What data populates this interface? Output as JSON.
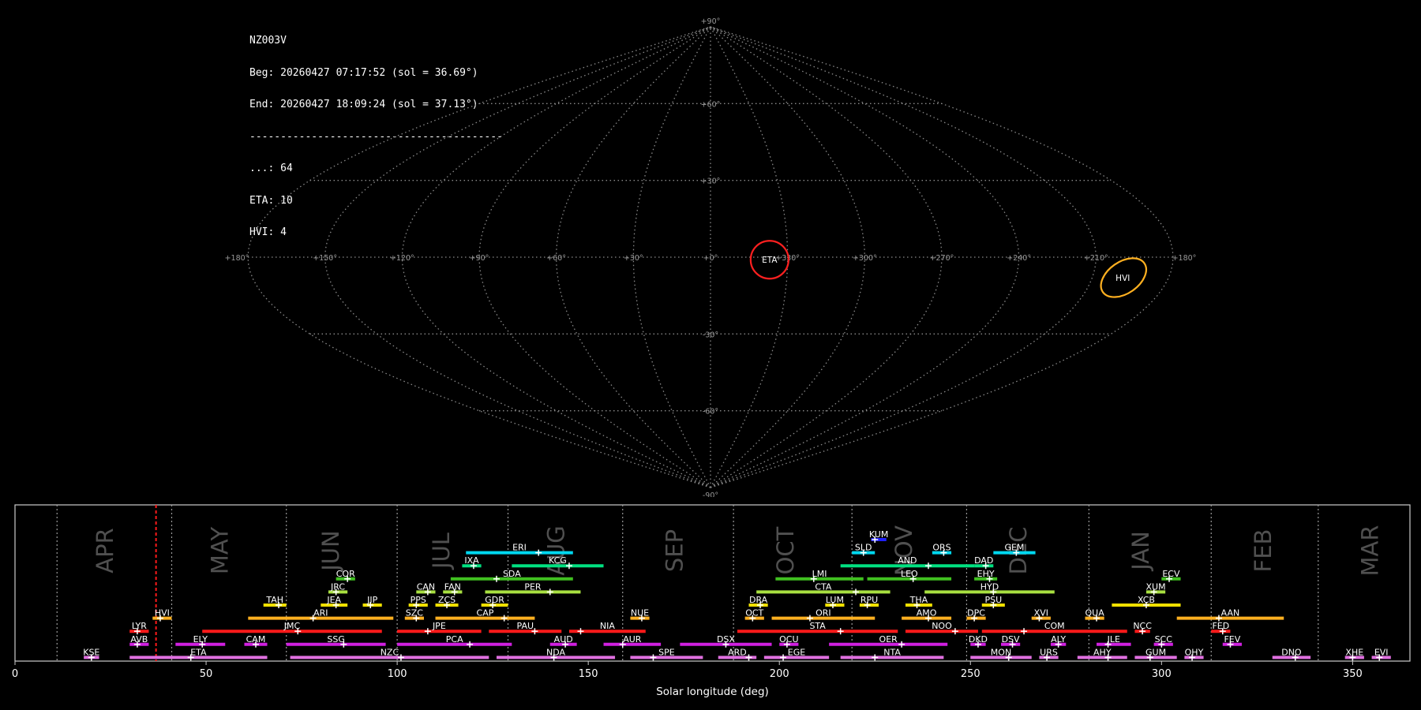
{
  "info": {
    "station": "NZ003V",
    "beg": "Beg: 20260427 07:17:52 (sol = 36.69°)",
    "end": "End: 20260427 18:09:24 (sol = 37.13°)",
    "separator": "-----------------------------------------",
    "counts": [
      "...: 64",
      "ETA: 10",
      "HVI: 4"
    ]
  },
  "sky_map": {
    "projection": "sinusoidal",
    "lon_labels": [
      "+180°",
      "+150°",
      "+120°",
      "+90°",
      "+60°",
      "+30°",
      "+0°",
      "+330°",
      "+300°",
      "+270°",
      "+240°",
      "+210°",
      "+180°"
    ],
    "lat_labels": [
      "+90°",
      "+60°",
      "+30°",
      "+0°",
      "-30°",
      "-60°",
      "-90°"
    ],
    "radiant_circles": [
      {
        "name": "ETA",
        "lon": 337,
        "lat": -1,
        "color": "#ff2020"
      },
      {
        "name": "HVI",
        "lon": 198,
        "lat": -8,
        "color": "#ffb020"
      }
    ]
  },
  "chart_data": {
    "type": "timeline",
    "xlabel": "Solar longitude (deg)",
    "xlim": [
      0,
      365
    ],
    "xticks": [
      0,
      50,
      100,
      150,
      200,
      250,
      300,
      350
    ],
    "grid": "vertical dotted month boundaries",
    "current_sol": 36.9,
    "months": [
      {
        "label": "APR",
        "center": 24
      },
      {
        "label": "MAY",
        "center": 54
      },
      {
        "label": "JUN",
        "center": 83
      },
      {
        "label": "JUL",
        "center": 112
      },
      {
        "label": "AUG",
        "center": 142
      },
      {
        "label": "SEP",
        "center": 173
      },
      {
        "label": "OCT",
        "center": 202
      },
      {
        "label": "NOV",
        "center": 233
      },
      {
        "label": "DEC",
        "center": 263
      },
      {
        "label": "JAN",
        "center": 295
      },
      {
        "label": "FEB",
        "center": 327
      },
      {
        "label": "MAR",
        "center": 355
      }
    ],
    "month_boundaries": [
      11,
      41,
      71,
      100,
      129,
      159,
      188,
      219,
      249,
      281,
      313,
      341
    ],
    "showers": [
      {
        "name": "KUM",
        "start": 224,
        "end": 228,
        "peak": 225,
        "row": 0,
        "color": "#2020ff"
      },
      {
        "name": "ERI",
        "start": 118,
        "end": 146,
        "peak": 137,
        "row": 1,
        "color": "#00d8f0"
      },
      {
        "name": "SLD",
        "start": 219,
        "end": 225,
        "peak": 222,
        "row": 1,
        "color": "#00d8f0"
      },
      {
        "name": "ORS",
        "start": 240,
        "end": 245,
        "peak": 243,
        "row": 1,
        "color": "#00d8f0"
      },
      {
        "name": "GEM",
        "start": 256,
        "end": 267,
        "peak": 262,
        "row": 1,
        "color": "#00d8f0"
      },
      {
        "name": "IXA",
        "start": 117,
        "end": 122,
        "peak": 120,
        "row": 2,
        "color": "#00e080"
      },
      {
        "name": "KCG",
        "start": 130,
        "end": 154,
        "peak": 145,
        "row": 2,
        "color": "#00e080"
      },
      {
        "name": "AND",
        "start": 216,
        "end": 251,
        "peak": 239,
        "row": 2,
        "color": "#00e080"
      },
      {
        "name": "DAD",
        "start": 251,
        "end": 256,
        "peak": 254,
        "row": 2,
        "color": "#00e080"
      },
      {
        "name": "COR",
        "start": 84,
        "end": 89,
        "peak": 87,
        "row": 3,
        "color": "#40c020"
      },
      {
        "name": "SDA",
        "start": 114,
        "end": 146,
        "peak": 126,
        "row": 3,
        "color": "#40c020"
      },
      {
        "name": "LMI",
        "start": 199,
        "end": 222,
        "peak": 209,
        "row": 3,
        "color": "#40c020"
      },
      {
        "name": "LEO",
        "start": 223,
        "end": 245,
        "peak": 235,
        "row": 3,
        "color": "#40c020"
      },
      {
        "name": "EHY",
        "start": 251,
        "end": 257,
        "peak": 255,
        "row": 3,
        "color": "#40c020"
      },
      {
        "name": "ECV",
        "start": 300,
        "end": 305,
        "peak": 302,
        "row": 3,
        "color": "#40c020"
      },
      {
        "name": "JRC",
        "start": 82,
        "end": 87,
        "peak": 84,
        "row": 4,
        "color": "#a8e040"
      },
      {
        "name": "CAN",
        "start": 105,
        "end": 110,
        "peak": 108,
        "row": 4,
        "color": "#a8e040"
      },
      {
        "name": "FAN",
        "start": 112,
        "end": 117,
        "peak": 115,
        "row": 4,
        "color": "#a8e040"
      },
      {
        "name": "PER",
        "start": 123,
        "end": 148,
        "peak": 140,
        "row": 4,
        "color": "#a8e040"
      },
      {
        "name": "CTA",
        "start": 194,
        "end": 229,
        "peak": 220,
        "row": 4,
        "color": "#a8e040"
      },
      {
        "name": "HYD",
        "start": 238,
        "end": 272,
        "peak": 256,
        "row": 4,
        "color": "#a8e040"
      },
      {
        "name": "XUM",
        "start": 296,
        "end": 301,
        "peak": 298,
        "row": 4,
        "color": "#a8e040"
      },
      {
        "name": "TAH",
        "start": 65,
        "end": 71,
        "peak": 69,
        "row": 5,
        "color": "#f0e000"
      },
      {
        "name": "JEA",
        "start": 80,
        "end": 87,
        "peak": 84,
        "row": 5,
        "color": "#f0e000"
      },
      {
        "name": "JIP",
        "start": 91,
        "end": 96,
        "peak": 93,
        "row": 5,
        "color": "#f0e000"
      },
      {
        "name": "PPS",
        "start": 103,
        "end": 108,
        "peak": 105,
        "row": 5,
        "color": "#f0e000"
      },
      {
        "name": "ZCS",
        "start": 110,
        "end": 116,
        "peak": 113,
        "row": 5,
        "color": "#f0e000"
      },
      {
        "name": "GDR",
        "start": 122,
        "end": 129,
        "peak": 125,
        "row": 5,
        "color": "#f0e000"
      },
      {
        "name": "DRA",
        "start": 192,
        "end": 197,
        "peak": 195,
        "row": 5,
        "color": "#f0e000"
      },
      {
        "name": "LUM",
        "start": 212,
        "end": 217,
        "peak": 214,
        "row": 5,
        "color": "#f0e000"
      },
      {
        "name": "RPU",
        "start": 221,
        "end": 226,
        "peak": 223,
        "row": 5,
        "color": "#f0e000"
      },
      {
        "name": "THA",
        "start": 233,
        "end": 240,
        "peak": 236,
        "row": 5,
        "color": "#f0e000"
      },
      {
        "name": "PSU",
        "start": 253,
        "end": 259,
        "peak": 256,
        "row": 5,
        "color": "#f0e000"
      },
      {
        "name": "XCB",
        "start": 287,
        "end": 305,
        "peak": 296,
        "row": 5,
        "color": "#f0e000"
      },
      {
        "name": "HVI",
        "start": 36,
        "end": 41,
        "peak": 38,
        "row": 6,
        "color": "#ffb020"
      },
      {
        "name": "ARI",
        "start": 61,
        "end": 99,
        "peak": 78,
        "row": 6,
        "color": "#ffb020"
      },
      {
        "name": "SZC",
        "start": 102,
        "end": 107,
        "peak": 105,
        "row": 6,
        "color": "#ffb020"
      },
      {
        "name": "CAP",
        "start": 110,
        "end": 136,
        "peak": 128,
        "row": 6,
        "color": "#ffb020"
      },
      {
        "name": "NUE",
        "start": 161,
        "end": 166,
        "peak": 164,
        "row": 6,
        "color": "#ffb020"
      },
      {
        "name": "OCT",
        "start": 191,
        "end": 196,
        "peak": 193,
        "row": 6,
        "color": "#ffb020"
      },
      {
        "name": "ORI",
        "start": 198,
        "end": 225,
        "peak": 208,
        "row": 6,
        "color": "#ffb020"
      },
      {
        "name": "AMO",
        "start": 232,
        "end": 245,
        "peak": 239,
        "row": 6,
        "color": "#ffb020"
      },
      {
        "name": "DPC",
        "start": 249,
        "end": 254,
        "peak": 251,
        "row": 6,
        "color": "#ffb020"
      },
      {
        "name": "XVI",
        "start": 266,
        "end": 271,
        "peak": 268,
        "row": 6,
        "color": "#ffb020"
      },
      {
        "name": "QUA",
        "start": 280,
        "end": 285,
        "peak": 283,
        "row": 6,
        "color": "#ffb020"
      },
      {
        "name": "AAN",
        "start": 304,
        "end": 332,
        "peak": 315,
        "row": 6,
        "color": "#ffb020"
      },
      {
        "name": "LYR",
        "start": 30,
        "end": 35,
        "peak": 32,
        "row": 7,
        "color": "#ff1a1a"
      },
      {
        "name": "JMC",
        "start": 49,
        "end": 96,
        "peak": 74,
        "row": 7,
        "color": "#ff1a1a"
      },
      {
        "name": "JPE",
        "start": 100,
        "end": 122,
        "peak": 108,
        "row": 7,
        "color": "#ff1a1a"
      },
      {
        "name": "PAU",
        "start": 124,
        "end": 143,
        "peak": 136,
        "row": 7,
        "color": "#ff1a1a"
      },
      {
        "name": "NIA",
        "start": 145,
        "end": 165,
        "peak": 148,
        "row": 7,
        "color": "#ff1a1a"
      },
      {
        "name": "STA",
        "start": 189,
        "end": 231,
        "peak": 216,
        "row": 7,
        "color": "#ff1a1a"
      },
      {
        "name": "NOO",
        "start": 233,
        "end": 252,
        "peak": 246,
        "row": 7,
        "color": "#ff1a1a"
      },
      {
        "name": "COM",
        "start": 253,
        "end": 291,
        "peak": 264,
        "row": 7,
        "color": "#ff1a1a"
      },
      {
        "name": "NCC",
        "start": 293,
        "end": 297,
        "peak": 295,
        "row": 7,
        "color": "#ff1a1a"
      },
      {
        "name": "FED",
        "start": 313,
        "end": 318,
        "peak": 316,
        "row": 7,
        "color": "#ff1a1a"
      },
      {
        "name": "AVB",
        "start": 30,
        "end": 35,
        "peak": 32,
        "row": 8,
        "color": "#d020e0"
      },
      {
        "name": "ELY",
        "start": 42,
        "end": 55,
        "peak": 49,
        "row": 8,
        "color": "#d020e0"
      },
      {
        "name": "CAM",
        "start": 60,
        "end": 66,
        "peak": 63,
        "row": 8,
        "color": "#d020e0"
      },
      {
        "name": "SSG",
        "start": 71,
        "end": 97,
        "peak": 86,
        "row": 8,
        "color": "#d020e0"
      },
      {
        "name": "PCA",
        "start": 100,
        "end": 130,
        "peak": 119,
        "row": 8,
        "color": "#d020e0"
      },
      {
        "name": "AUD",
        "start": 140,
        "end": 147,
        "peak": 144,
        "row": 8,
        "color": "#d020e0"
      },
      {
        "name": "AUR",
        "start": 154,
        "end": 169,
        "peak": 159,
        "row": 8,
        "color": "#d020e0"
      },
      {
        "name": "DSX",
        "start": 174,
        "end": 198,
        "peak": 186,
        "row": 8,
        "color": "#d020e0"
      },
      {
        "name": "OCU",
        "start": 200,
        "end": 205,
        "peak": 202,
        "row": 8,
        "color": "#d020e0"
      },
      {
        "name": "OER",
        "start": 213,
        "end": 244,
        "peak": 232,
        "row": 8,
        "color": "#d020e0"
      },
      {
        "name": "DKD",
        "start": 250,
        "end": 254,
        "peak": 252,
        "row": 8,
        "color": "#d020e0"
      },
      {
        "name": "DSV",
        "start": 258,
        "end": 263,
        "peak": 261,
        "row": 8,
        "color": "#d020e0"
      },
      {
        "name": "ALY",
        "start": 271,
        "end": 275,
        "peak": 273,
        "row": 8,
        "color": "#d020e0"
      },
      {
        "name": "JLE",
        "start": 283,
        "end": 292,
        "peak": 286,
        "row": 8,
        "color": "#d020e0"
      },
      {
        "name": "SCC",
        "start": 298,
        "end": 303,
        "peak": 300,
        "row": 8,
        "color": "#d020e0"
      },
      {
        "name": "FEV",
        "start": 316,
        "end": 321,
        "peak": 318,
        "row": 8,
        "color": "#d020e0"
      },
      {
        "name": "KSE",
        "start": 18,
        "end": 22,
        "peak": 20,
        "row": 9,
        "color": "#e070e0"
      },
      {
        "name": "ETA",
        "start": 30,
        "end": 66,
        "peak": 46,
        "row": 9,
        "color": "#e070e0"
      },
      {
        "name": "NZC",
        "start": 72,
        "end": 124,
        "peak": 101,
        "row": 9,
        "color": "#e070e0"
      },
      {
        "name": "NDA",
        "start": 126,
        "end": 157,
        "peak": 141,
        "row": 9,
        "color": "#e070e0"
      },
      {
        "name": "SPE",
        "start": 161,
        "end": 180,
        "peak": 167,
        "row": 9,
        "color": "#e070e0"
      },
      {
        "name": "ARD",
        "start": 184,
        "end": 194,
        "peak": 192,
        "row": 9,
        "color": "#e070e0"
      },
      {
        "name": "EGE",
        "start": 196,
        "end": 213,
        "peak": 201,
        "row": 9,
        "color": "#e070e0"
      },
      {
        "name": "NTA",
        "start": 216,
        "end": 243,
        "peak": 225,
        "row": 9,
        "color": "#e070e0"
      },
      {
        "name": "MON",
        "start": 250,
        "end": 266,
        "peak": 260,
        "row": 9,
        "color": "#e070e0"
      },
      {
        "name": "URS",
        "start": 268,
        "end": 273,
        "peak": 270,
        "row": 9,
        "color": "#e070e0"
      },
      {
        "name": "AHY",
        "start": 278,
        "end": 291,
        "peak": 286,
        "row": 9,
        "color": "#e070e0"
      },
      {
        "name": "GUM",
        "start": 293,
        "end": 304,
        "peak": 297,
        "row": 9,
        "color": "#e070e0"
      },
      {
        "name": "OHY",
        "start": 306,
        "end": 311,
        "peak": 308,
        "row": 9,
        "color": "#e070e0"
      },
      {
        "name": "DNO",
        "start": 329,
        "end": 339,
        "peak": 335,
        "row": 9,
        "color": "#e070e0"
      },
      {
        "name": "XHE",
        "start": 348,
        "end": 353,
        "peak": 350,
        "row": 9,
        "color": "#e070e0"
      },
      {
        "name": "EVI",
        "start": 355,
        "end": 360,
        "peak": 357,
        "row": 9,
        "color": "#e070e0"
      }
    ]
  }
}
